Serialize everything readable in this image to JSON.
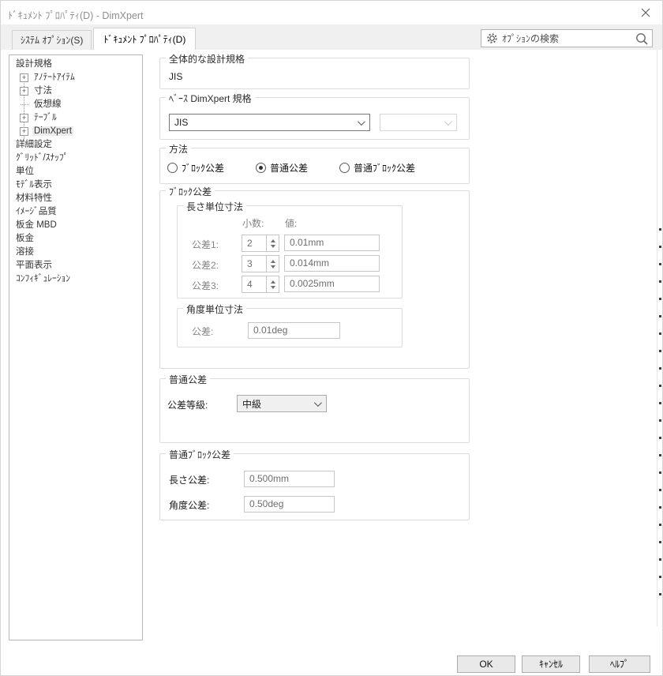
{
  "window": {
    "title": "ﾄﾞｷｭﾒﾝﾄ ﾌﾟﾛﾊﾟﾃｨ(D) - DimXpert"
  },
  "icons": {
    "gear": "gear-shape",
    "search": "magnifier-shape",
    "close": "x-shape",
    "chevron_down": "v-shape",
    "spinner_up": "triangle-up",
    "spinner_down": "triangle-down",
    "expander_plus": "+"
  },
  "tabs": [
    {
      "label": "ｼｽﾃﾑ ｵﾌﾟｼｮﾝ(S)",
      "active": false
    },
    {
      "label": "ﾄﾞｷｭﾒﾝﾄ ﾌﾟﾛﾊﾟﾃｨ(D)",
      "active": true
    }
  ],
  "search": {
    "placeholder": "ｵﾌﾟｼｮﾝの検索"
  },
  "tree": {
    "items": [
      {
        "label": "設計規格",
        "level": 0
      },
      {
        "label": "ｱﾉﾃｰﾄｱｲﾃﾑ",
        "level": 1,
        "expander": true
      },
      {
        "label": "寸法",
        "level": 1,
        "expander": true
      },
      {
        "label": "仮想線",
        "level": 1,
        "leaf": true
      },
      {
        "label": "ﾃｰﾌﾞﾙ",
        "level": 1,
        "expander": true
      },
      {
        "label": "DimXpert",
        "level": 1,
        "expander": true,
        "selected": true
      },
      {
        "label": "詳細設定",
        "level": 0
      },
      {
        "label": "ｸﾞﾘｯﾄﾞ/ｽﾅｯﾌﾟ",
        "level": 0
      },
      {
        "label": "単位",
        "level": 0
      },
      {
        "label": "ﾓﾃﾞﾙ表示",
        "level": 0
      },
      {
        "label": "材料特性",
        "level": 0
      },
      {
        "label": "ｲﾒｰｼﾞ品質",
        "level": 0
      },
      {
        "label": "板金 MBD",
        "level": 0
      },
      {
        "label": "板金",
        "level": 0
      },
      {
        "label": "溶接",
        "level": 0
      },
      {
        "label": "平面表示",
        "level": 0
      },
      {
        "label": "ｺﾝﾌｨｷﾞｭﾚｰｼｮﾝ",
        "level": 0
      }
    ]
  },
  "main": {
    "overall_standard": {
      "title": "全体的な設計規格",
      "value": "JIS"
    },
    "base_standard": {
      "title": "ﾍﾞｰｽ DimXpert 規格",
      "combo1": "JIS",
      "combo2": ""
    },
    "method": {
      "title": "方法",
      "options": [
        {
          "label": "ﾌﾞﾛｯｸ公差",
          "selected": false
        },
        {
          "label": "普通公差",
          "selected": true
        },
        {
          "label": "普通ﾌﾞﾛｯｸ公差",
          "selected": false
        }
      ]
    },
    "block_tolerance": {
      "title": "ﾌﾞﾛｯｸ公差",
      "length_group": {
        "title": "長さ単位寸法",
        "col_decimal": "小数:",
        "col_value": "値:",
        "rows": [
          {
            "label": "公差1:",
            "decimal": "2",
            "value": "0.01mm"
          },
          {
            "label": "公差2:",
            "decimal": "3",
            "value": "0.014mm"
          },
          {
            "label": "公差3:",
            "decimal": "4",
            "value": "0.0025mm"
          }
        ]
      },
      "angle_group": {
        "title": "角度単位寸法",
        "label": "公差:",
        "value": "0.01deg"
      }
    },
    "general_tolerance": {
      "title": "普通公差",
      "label": "公差等級:",
      "value": "中級"
    },
    "general_block_tolerance": {
      "title": "普通ﾌﾞﾛｯｸ公差",
      "length_label": "長さ公差:",
      "length_value": "0.500mm",
      "angle_label": "角度公差:",
      "angle_value": "0.50deg"
    }
  },
  "footer": {
    "ok": "OK",
    "cancel": "ｷｬﾝｾﾙ",
    "help": "ﾍﾙﾌﾟ"
  }
}
